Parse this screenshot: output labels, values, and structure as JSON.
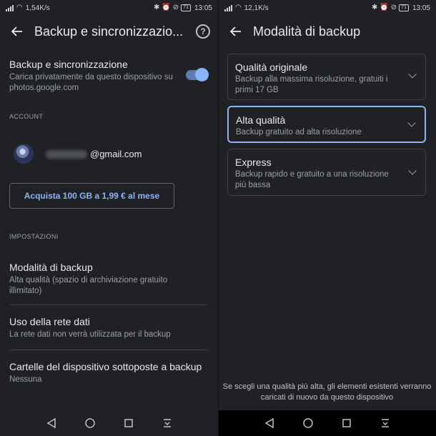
{
  "left": {
    "status": {
      "speed": "1,54K/s",
      "battery": "71",
      "time": "13:05"
    },
    "appbar": {
      "title": "Backup e sincronizzazio...",
      "help": "?"
    },
    "backup_toggle": {
      "title": "Backup e sincronizzazione",
      "subtitle": "Carica privatamente da questo dispositivo su photos.google.com",
      "enabled": true
    },
    "account_label": "ACCOUNT",
    "account": {
      "email_suffix": "@gmail.com"
    },
    "buy_button": "Acquista 100 GB a 1,99 € al mese",
    "settings_label": "IMPOSTAZIONI",
    "settings": [
      {
        "title": "Modalità di backup",
        "subtitle": "Alta qualità (spazio di archiviazione gratuito illimitato)"
      },
      {
        "title": "Uso della rete dati",
        "subtitle": "La rete dati non verrà utilizzata per il backup"
      },
      {
        "title": "Cartelle del dispositivo sottoposte a backup",
        "subtitle": "Nessuna"
      }
    ]
  },
  "right": {
    "status": {
      "speed": "12,1K/s",
      "battery": "71",
      "time": "13:05"
    },
    "appbar": {
      "title": "Modalità di backup"
    },
    "options": [
      {
        "title": "Qualità originale",
        "subtitle": "Backup alla massima risoluzione, gratuiti i primi 17 GB",
        "selected": false
      },
      {
        "title": "Alta qualità",
        "subtitle": "Backup gratuito ad alta risoluzione",
        "selected": true
      },
      {
        "title": "Express",
        "subtitle": "Backup rapido e gratuito a una risoluzione più bassa",
        "selected": false
      }
    ],
    "footnote": "Se scegli una qualità più alta, gli elementi esistenti verranno caricati di nuovo da questo dispositivo"
  },
  "icons": {
    "back": "arrow-back-icon",
    "help": "help-circle-icon",
    "chevron": "chevron-down-icon",
    "nav": [
      "nav-back-icon",
      "nav-home-icon",
      "nav-recents-icon",
      "nav-notifications-icon"
    ]
  },
  "colors": {
    "background": "#202124",
    "accent": "#8ab4f8",
    "text": "#e8eaed",
    "secondary": "#9aa0a6"
  }
}
